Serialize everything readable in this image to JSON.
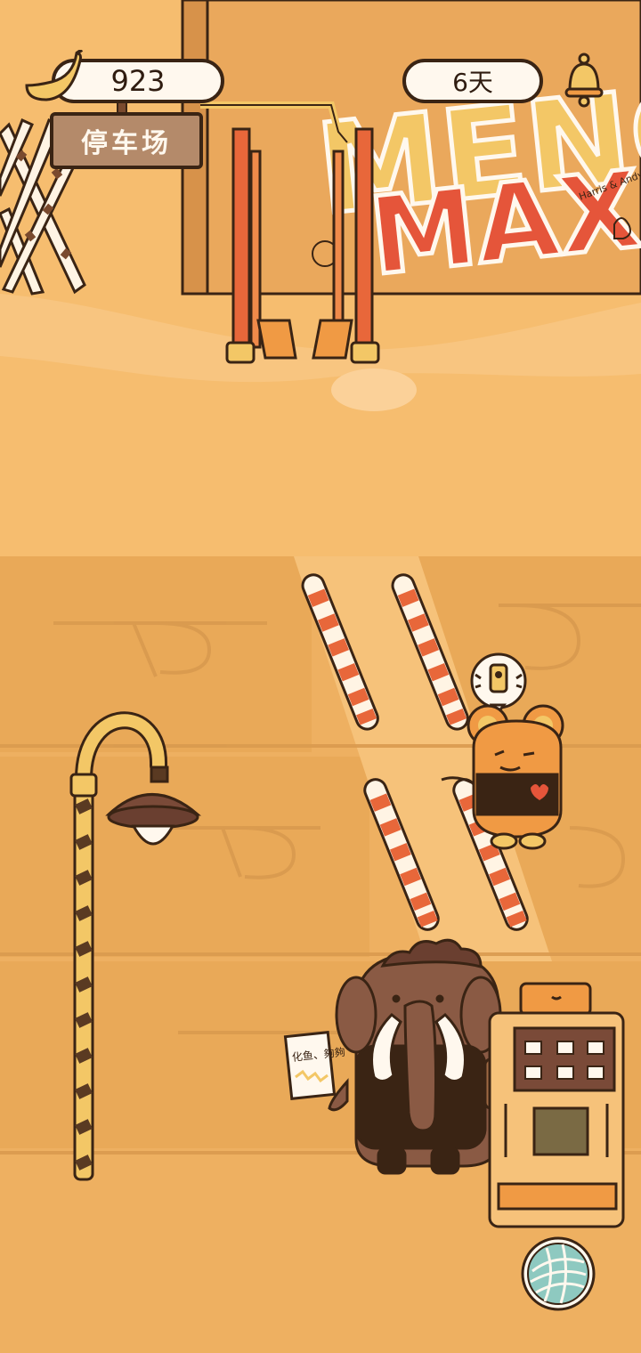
{
  "hud": {
    "banana_count": "923",
    "days": "6天",
    "location_sign": "停车场"
  },
  "scene": {
    "graffiti_line1": "MENG",
    "graffiti_line2": "MAX",
    "graffiti_note": "Harris & Andy forever",
    "note_paper_text": "化鱼、夠夠"
  },
  "colors": {
    "sand": "#f6bd6f",
    "wall": "#eaa85c",
    "parking_lot": "#eeb061",
    "barrier_orange": "#e8673a",
    "outline": "#3a2414",
    "pill_bg": "#fff8ee"
  }
}
